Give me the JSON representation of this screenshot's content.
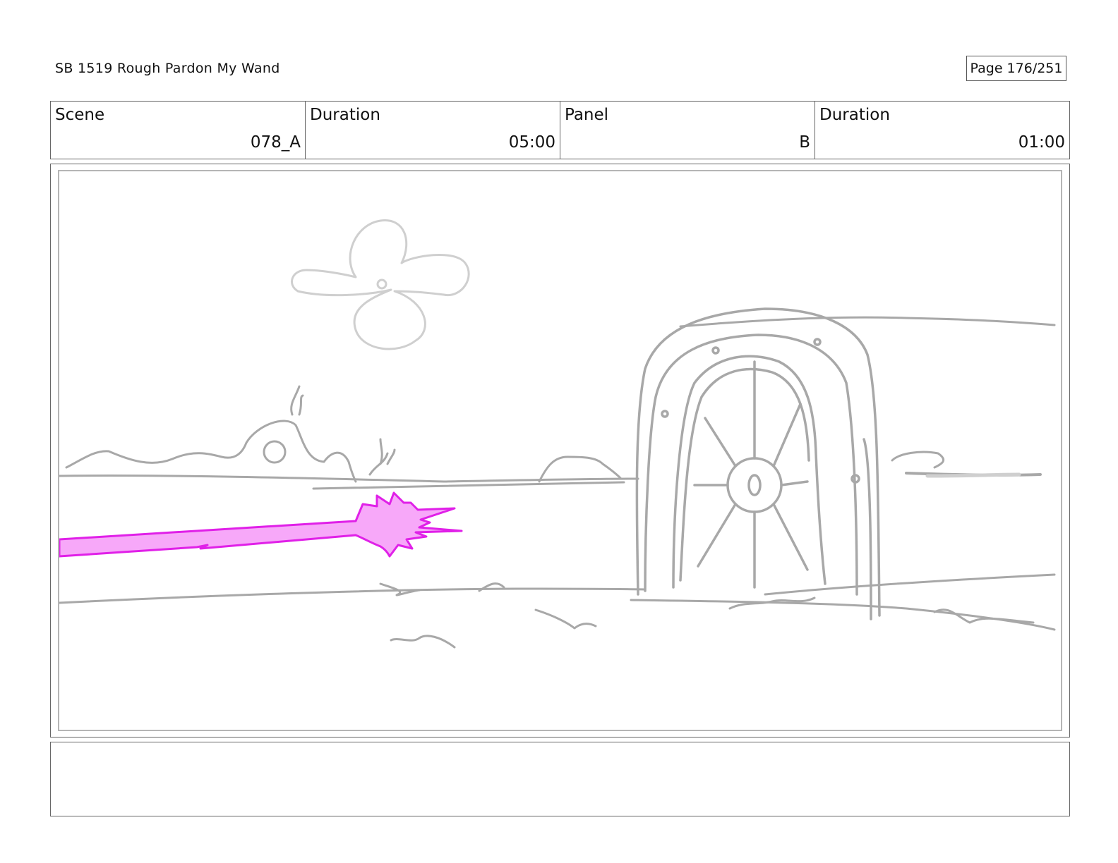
{
  "header": {
    "title": "SB 1519 Rough  Pardon My Wand",
    "page": "Page 176/251"
  },
  "info": {
    "scene_label": "Scene",
    "scene_value": "078_A",
    "duration_label": "Duration",
    "duration_value": "05:00",
    "panel_label": "Panel",
    "panel_value": "B",
    "panel_duration_label": "Duration",
    "panel_duration_value": "01:00"
  },
  "sketch": {
    "line_color": "#a8a8a8",
    "beam_color": "#e020e8",
    "beam_fill": "#f7a8f9"
  },
  "notes": {
    "text": ""
  }
}
